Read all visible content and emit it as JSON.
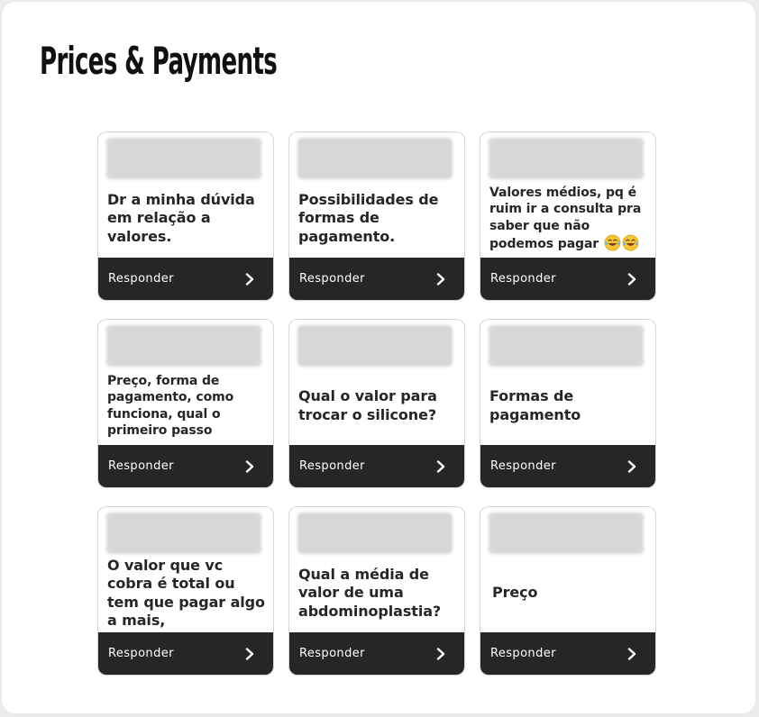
{
  "page": {
    "title": "Prices & Payments"
  },
  "cards": [
    {
      "question": "Dr a minha dúvida em relação a valores.",
      "reply_label": "Responder"
    },
    {
      "question": "Possibilidades de formas de pagamento.",
      "reply_label": "Responder"
    },
    {
      "question": "Valores médios, pq é ruim ir a consulta pra saber que não podemos pagar",
      "emojis": [
        "laughing-crying-emoji",
        "laughing-crying-emoji"
      ],
      "reply_label": "Responder"
    },
    {
      "question": "Preço, forma de pagamento, como funciona, qual o primeiro passo",
      "reply_label": "Responder"
    },
    {
      "question": "Qual o valor para trocar o silicone?",
      "reply_label": "Responder"
    },
    {
      "question": "Formas de pagamento",
      "reply_label": "Responder"
    },
    {
      "question": "O valor que vc cobra é total ou tem que pagar algo a mais,",
      "reply_label": "Responder"
    },
    {
      "question": "Qual a média de valor de uma abdominoplastia?",
      "reply_label": "Responder"
    },
    {
      "question": "Preço",
      "reply_label": "Responder"
    }
  ],
  "colors": {
    "reply_bar": "#262626",
    "question_text": "#262626",
    "blurred_header": "#d7d7d7",
    "panel_background": "#ffffff"
  },
  "icons": {
    "reply_arrow": "chevron-right-icon",
    "emoji": "laughing-crying-emoji"
  }
}
